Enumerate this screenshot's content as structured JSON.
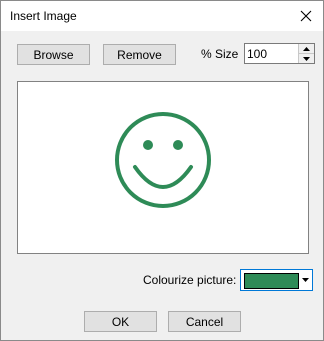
{
  "window": {
    "title": "Insert Image"
  },
  "toolbar": {
    "browse_label": "Browse",
    "remove_label": "Remove",
    "size_label": "% Size",
    "size_value": "100"
  },
  "preview": {
    "image": "smiley-face",
    "color": "#2e8b57"
  },
  "colorize": {
    "label": "Colourize picture:",
    "selected_color": "#2e8b57"
  },
  "footer": {
    "ok_label": "OK",
    "cancel_label": "Cancel"
  },
  "icons": {
    "close": "close-icon",
    "spin_up": "spin-up-icon",
    "spin_down": "spin-down-icon",
    "dropdown": "chevron-down-icon"
  }
}
